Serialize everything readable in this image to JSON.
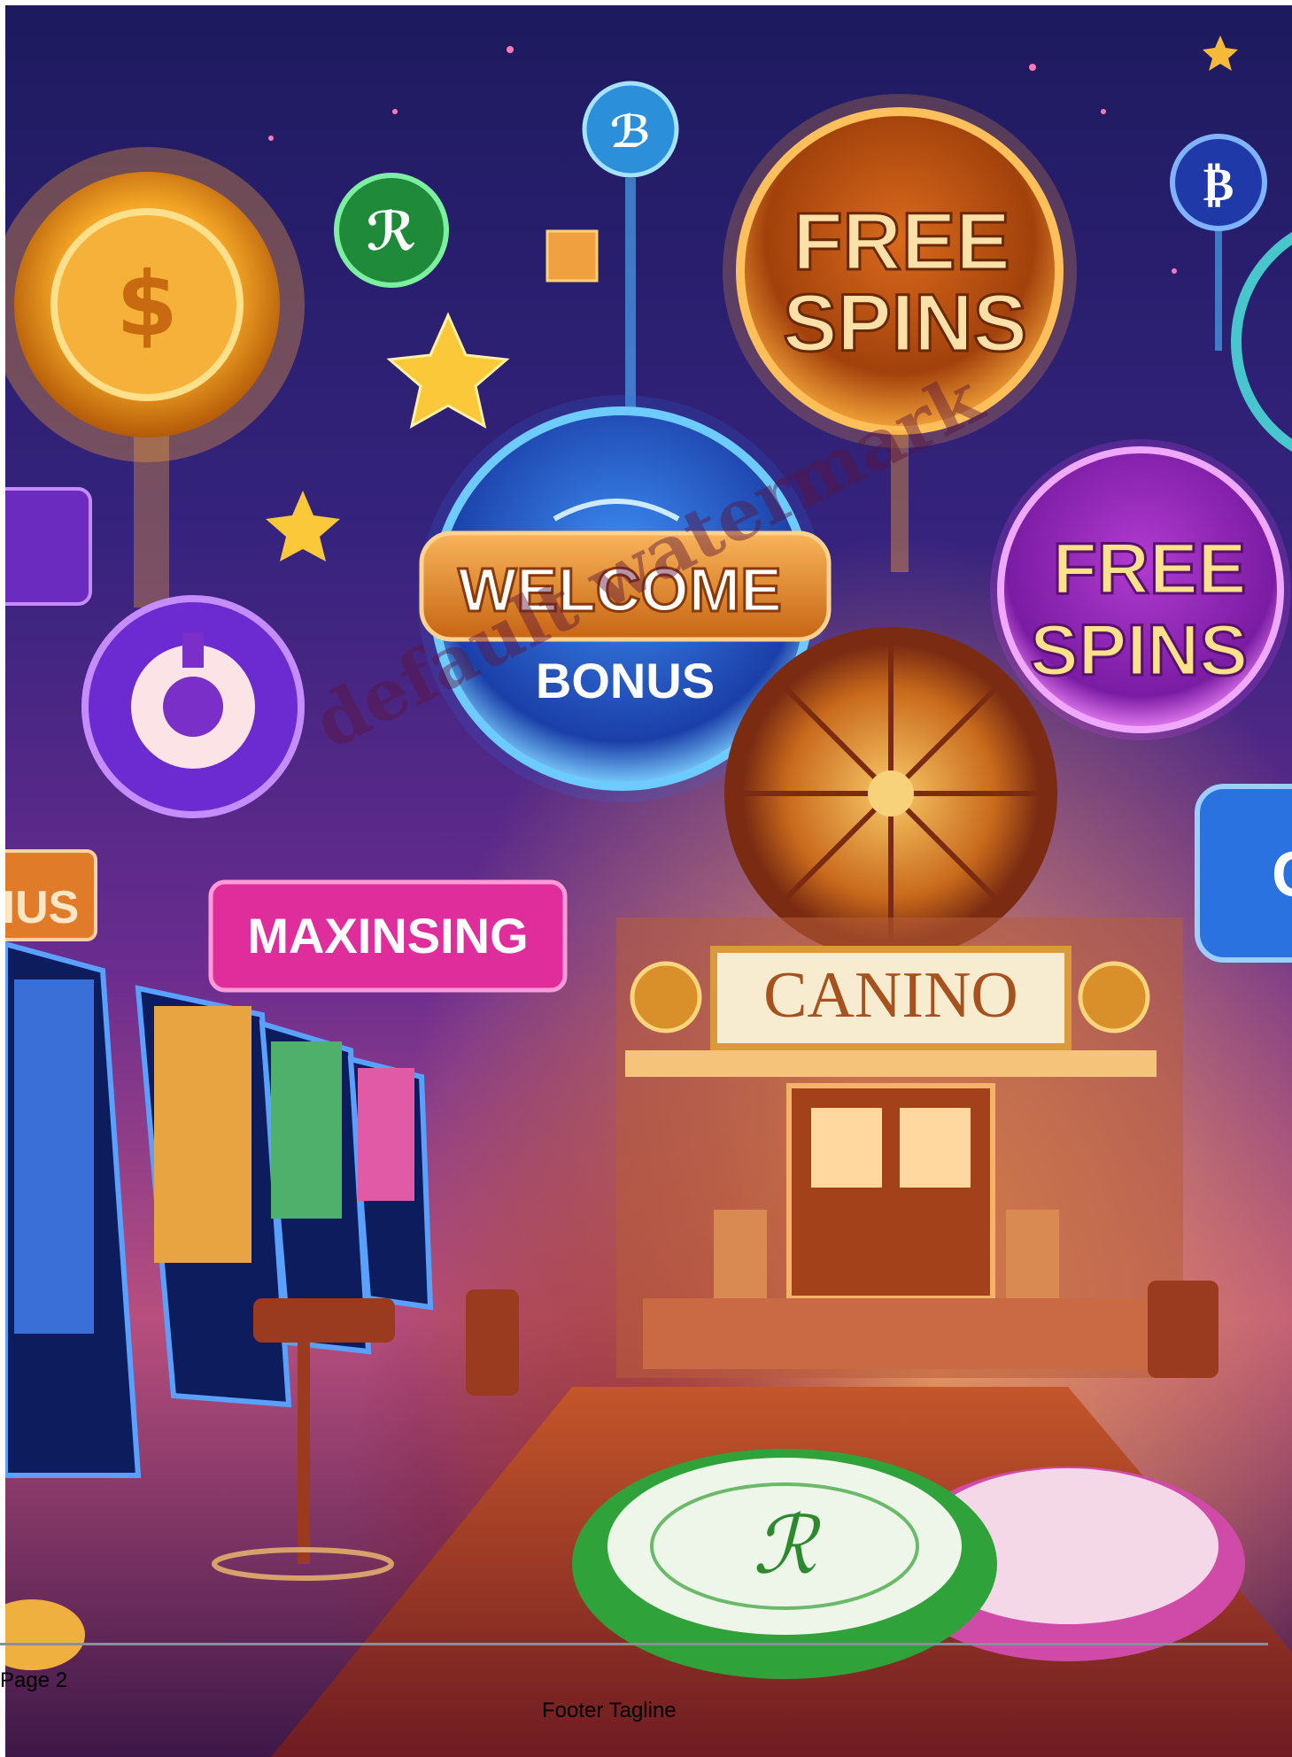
{
  "poster": {
    "free_spins_top": [
      "FREE",
      "SPINS"
    ],
    "free_spins_right": [
      "FREE",
      "SPINS"
    ],
    "welcome": "WELCOME",
    "bonus": "BONUS",
    "maxinsing": "MAXINSING",
    "canino": "CANINO",
    "edge_sign_left": "IUS",
    "edge_sign_right": "C"
  },
  "watermark": "default watermark",
  "footer": {
    "page_number": "Page 2",
    "tagline": "Footer Tagline"
  }
}
